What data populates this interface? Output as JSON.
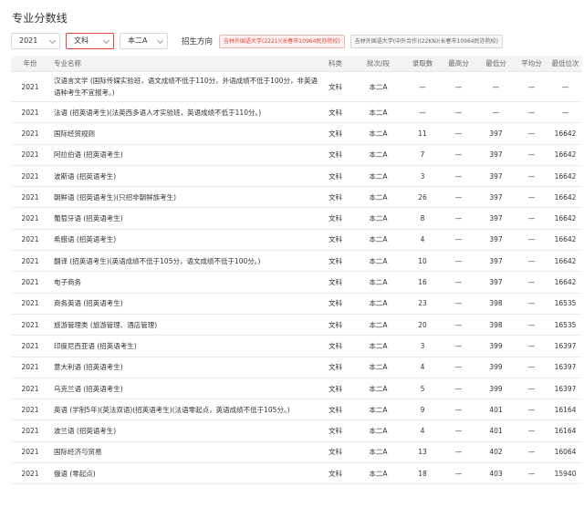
{
  "page": {
    "title": "专业分数线"
  },
  "filters": {
    "year": "2021",
    "subject": "文科",
    "batch": "本二A",
    "enroll_direction_label": "招生方向",
    "directions": [
      {
        "label": "吉林外国语大学(2221)(长春市10964民办院校)",
        "active": true
      },
      {
        "label": "吉林外国语大学(中外合作)(22KN)(长春市10964民办院校)",
        "active": false
      }
    ]
  },
  "table": {
    "columns": [
      "年份",
      "专业名称",
      "科类",
      "批次/段",
      "录取数",
      "最高分",
      "最低分",
      "平均分",
      "最低位次"
    ],
    "rows": [
      {
        "year": "2021",
        "name": "汉语言文学 (国际传媒实验班，语文成绩不低于110分，外语成绩不低于100分，非英语语种考生不宜报考。)",
        "kind": "文科",
        "batch": "本二A",
        "count": "—",
        "max": "—",
        "min": "—",
        "avg": "—",
        "rank": "—"
      },
      {
        "year": "2021",
        "name": "法语 (招英语考生)(法英西多语人才实验班，英语成绩不低于110分。)",
        "kind": "文科",
        "batch": "本二A",
        "count": "—",
        "max": "—",
        "min": "—",
        "avg": "—",
        "rank": "—"
      },
      {
        "year": "2021",
        "name": "国际经贸规则",
        "kind": "文科",
        "batch": "本二A",
        "count": "11",
        "max": "—",
        "min": "397",
        "avg": "—",
        "rank": "16642"
      },
      {
        "year": "2021",
        "name": "阿拉伯语 (招英语考生)",
        "kind": "文科",
        "batch": "本二A",
        "count": "7",
        "max": "—",
        "min": "397",
        "avg": "—",
        "rank": "16642"
      },
      {
        "year": "2021",
        "name": "波斯语 (招英语考生)",
        "kind": "文科",
        "batch": "本二A",
        "count": "3",
        "max": "—",
        "min": "397",
        "avg": "—",
        "rank": "16642"
      },
      {
        "year": "2021",
        "name": "朝鲜语 (招英语考生)(只招非朝鲜族考生)",
        "kind": "文科",
        "batch": "本二A",
        "count": "26",
        "max": "—",
        "min": "397",
        "avg": "—",
        "rank": "16642"
      },
      {
        "year": "2021",
        "name": "葡萄牙语 (招英语考生)",
        "kind": "文科",
        "batch": "本二A",
        "count": "8",
        "max": "—",
        "min": "397",
        "avg": "—",
        "rank": "16642"
      },
      {
        "year": "2021",
        "name": "希腊语 (招英语考生)",
        "kind": "文科",
        "batch": "本二A",
        "count": "4",
        "max": "—",
        "min": "397",
        "avg": "—",
        "rank": "16642"
      },
      {
        "year": "2021",
        "name": "翻译 (招英语考生)(英语成绩不低于105分，语文成绩不低于100分。)",
        "kind": "文科",
        "batch": "本二A",
        "count": "10",
        "max": "—",
        "min": "397",
        "avg": "—",
        "rank": "16642"
      },
      {
        "year": "2021",
        "name": "电子商务",
        "kind": "文科",
        "batch": "本二A",
        "count": "16",
        "max": "—",
        "min": "397",
        "avg": "—",
        "rank": "16642"
      },
      {
        "year": "2021",
        "name": "商务英语 (招英语考生)",
        "kind": "文科",
        "batch": "本二A",
        "count": "23",
        "max": "—",
        "min": "398",
        "avg": "—",
        "rank": "16535"
      },
      {
        "year": "2021",
        "name": "旅游管理类 (旅游管理、酒店管理)",
        "kind": "文科",
        "batch": "本二A",
        "count": "20",
        "max": "—",
        "min": "398",
        "avg": "—",
        "rank": "16535"
      },
      {
        "year": "2021",
        "name": "印度尼西亚语 (招英语考生)",
        "kind": "文科",
        "batch": "本二A",
        "count": "3",
        "max": "—",
        "min": "399",
        "avg": "—",
        "rank": "16397"
      },
      {
        "year": "2021",
        "name": "意大利语 (招英语考生)",
        "kind": "文科",
        "batch": "本二A",
        "count": "4",
        "max": "—",
        "min": "399",
        "avg": "—",
        "rank": "16397"
      },
      {
        "year": "2021",
        "name": "乌克兰语 (招英语考生)",
        "kind": "文科",
        "batch": "本二A",
        "count": "5",
        "max": "—",
        "min": "399",
        "avg": "—",
        "rank": "16397"
      },
      {
        "year": "2021",
        "name": "英语 (学制5年)(英法双语)(招英语考生)(法语零起点，英语成绩不低于105分。)",
        "kind": "文科",
        "batch": "本二A",
        "count": "9",
        "max": "—",
        "min": "401",
        "avg": "—",
        "rank": "16164"
      },
      {
        "year": "2021",
        "name": "波兰语 (招英语考生)",
        "kind": "文科",
        "batch": "本二A",
        "count": "4",
        "max": "—",
        "min": "401",
        "avg": "—",
        "rank": "16164"
      },
      {
        "year": "2021",
        "name": "国际经济与贸易",
        "kind": "文科",
        "batch": "本二A",
        "count": "13",
        "max": "—",
        "min": "402",
        "avg": "—",
        "rank": "16064"
      },
      {
        "year": "2021",
        "name": "俄语 (零起点)",
        "kind": "文科",
        "batch": "本二A",
        "count": "18",
        "max": "—",
        "min": "403",
        "avg": "—",
        "rank": "15940"
      }
    ]
  }
}
